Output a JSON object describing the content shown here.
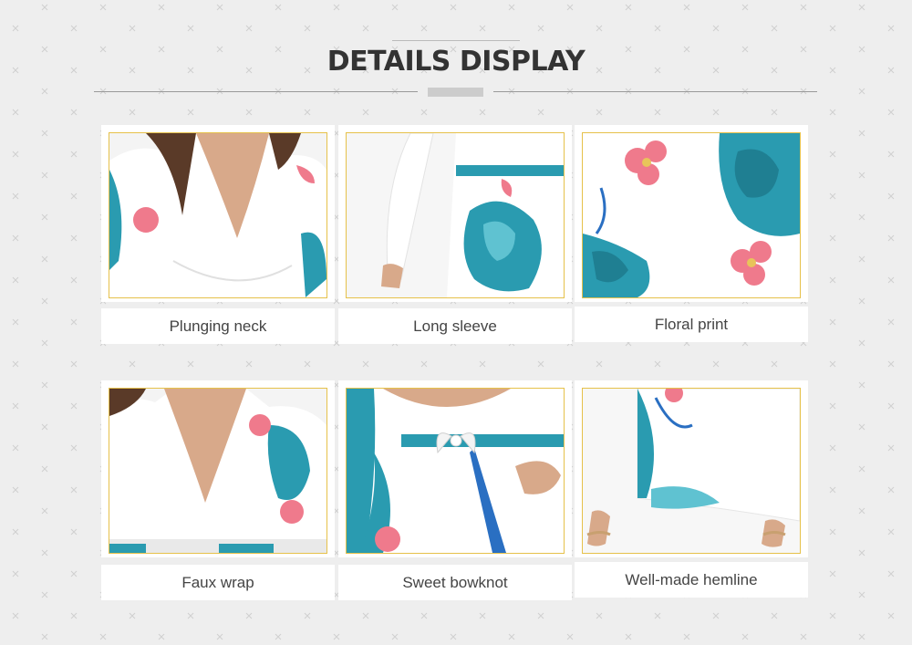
{
  "header": {
    "title": "DETAILS DISPLAY"
  },
  "details": [
    {
      "caption": "Plunging neck",
      "image": "plunging-neck-photo"
    },
    {
      "caption": "Long sleeve",
      "image": "long-sleeve-photo"
    },
    {
      "caption": "Floral print",
      "image": "floral-print-photo"
    },
    {
      "caption": "Faux wrap",
      "image": "faux-wrap-photo"
    },
    {
      "caption": "Sweet bowknot",
      "image": "sweet-bowknot-photo"
    },
    {
      "caption": "Well-made hemline",
      "image": "hemline-photo"
    }
  ],
  "colors": {
    "background": "#eeeeee",
    "frame": "#e6c14a",
    "print_teal": "#2a9bb0",
    "print_pink": "#ef7a8c",
    "dress_white": "#ffffff",
    "title": "#333333"
  }
}
